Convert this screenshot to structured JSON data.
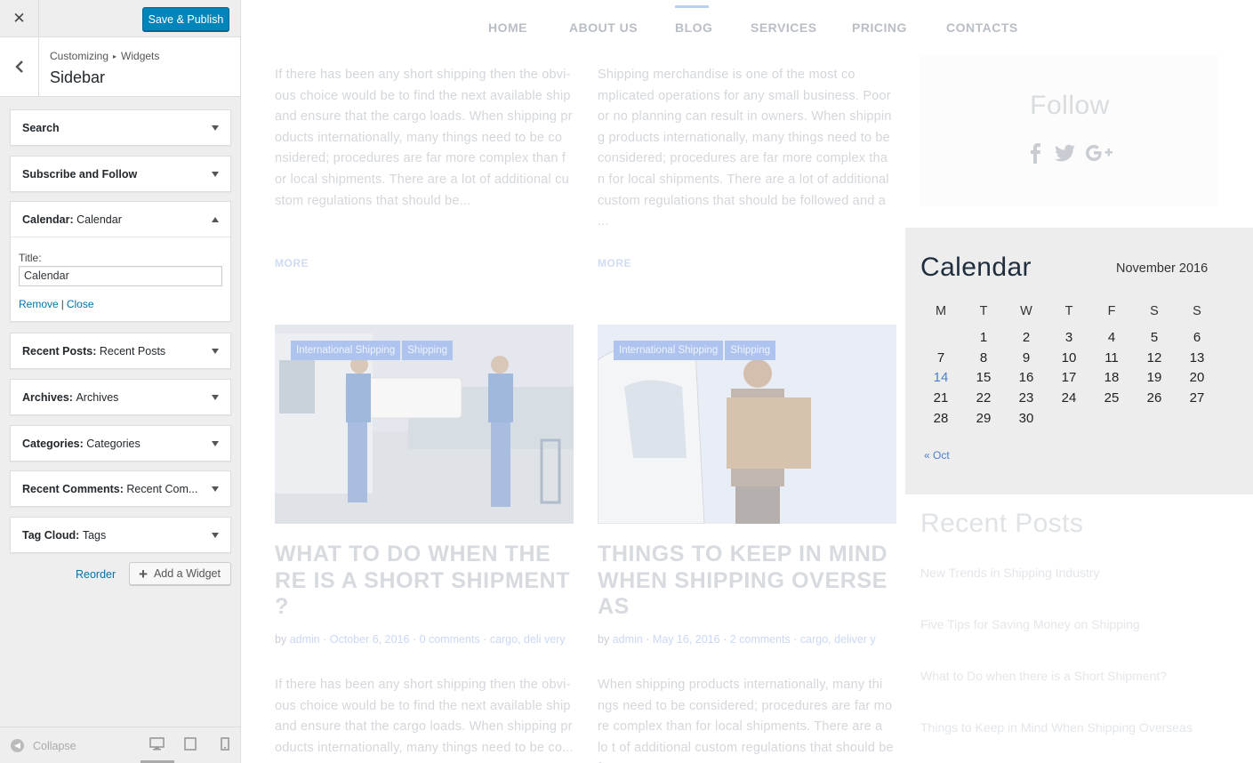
{
  "panel": {
    "publish_label": "Save & Publish",
    "breadcrumb": {
      "root": "Customizing",
      "sep": "▸",
      "current": "Widgets"
    },
    "section_title": "Sidebar",
    "widgets": [
      {
        "prefix": "Search",
        "name": ""
      },
      {
        "prefix": "Subscribe and Follow",
        "name": ""
      },
      {
        "prefix": "Calendar:",
        "name": "Calendar"
      },
      {
        "prefix": "Recent Posts:",
        "name": "Recent Posts"
      },
      {
        "prefix": "Archives:",
        "name": "Archives"
      },
      {
        "prefix": "Categories:",
        "name": "Categories"
      },
      {
        "prefix": "Recent Comments:",
        "name": "Recent Com..."
      },
      {
        "prefix": "Tag Cloud:",
        "name": "Tags"
      }
    ],
    "calendar_form": {
      "title_label": "Title:",
      "title_value": "Calendar",
      "remove_label": "Remove",
      "sep": "|",
      "close_label": "Close"
    },
    "reorder_label": "Reorder",
    "add_widget_label": "Add a Widget",
    "collapse_label": "Collapse"
  },
  "preview": {
    "nav": [
      "HOME",
      "ABOUT US",
      "BLOG",
      "SERVICES",
      "PRICING",
      "CONTACTS"
    ],
    "nav_active": "BLOG",
    "top_posts": [
      {
        "excerpt": "If there has been any short shipping then the obvi-ous choice would be to find the next available ship and ensure that the cargo loads. When shipping pr oducts internationally, many things need to be co nsidered; procedures are far more complex than f or local shipments. There are a lot of additional cu stom regulations that should be...",
        "more": "MORE"
      },
      {
        "excerpt": "Shipping merchandise is one of the most co mplicated operations for any small business. Poor or no planning can result in owners. When shippin g products internationally, many things need to be considered; procedures are far more complex tha n for local shipments. There are a lot of additional custom regulations that should be followed and a ...",
        "more": "MORE"
      }
    ],
    "posts": [
      {
        "tags": [
          "International Shipping",
          "Shipping"
        ],
        "title": "WHAT TO DO WHEN THE RE IS A SHORT SHIPMENT ?",
        "meta": {
          "by": "by",
          "author": "admin",
          "date": "October 6, 2016",
          "comments": "0 comments",
          "cats": "cargo, deli very"
        },
        "excerpt": "If there has been any short shipping then the obvi-ous choice would be to find the next available ship and ensure that the cargo loads. When shipping pr oducts internationally, many things need to be co..."
      },
      {
        "tags": [
          "International Shipping",
          "Shipping"
        ],
        "title": "THINGS TO KEEP IN MIND WHEN SHIPPING OVERSE AS",
        "meta": {
          "by": "by",
          "author": "admin",
          "date": "May 16, 2016",
          "comments": "2 comments",
          "cats": "cargo, deliver y"
        },
        "excerpt": "When shipping products internationally, many thi ngs need to be considered; procedures are far mo re complex than for local shipments. There are a lo t of additional custom regulations that should be f..."
      }
    ],
    "follow_title": "Follow",
    "calendar": {
      "title": "Calendar",
      "month": "November 2016",
      "weekdays": [
        "M",
        "T",
        "W",
        "T",
        "F",
        "S",
        "S"
      ],
      "weeks": [
        [
          "",
          "1",
          "2",
          "3",
          "4",
          "5",
          "6"
        ],
        [
          "7",
          "8",
          "9",
          "10",
          "11",
          "12",
          "13"
        ],
        [
          "14",
          "15",
          "16",
          "17",
          "18",
          "19",
          "20"
        ],
        [
          "21",
          "22",
          "23",
          "24",
          "25",
          "26",
          "27"
        ],
        [
          "28",
          "29",
          "30",
          "",
          "",
          "",
          ""
        ]
      ],
      "today": "14",
      "prev_link": "« Oct"
    },
    "recent_posts": {
      "title": "Recent Posts",
      "items": [
        "New Trends in Shipping Industry",
        "Five Tips for Saving Money on Shipping",
        "What to Do when there is a Short Shipment?",
        "Things to Keep in Mind When Shipping Overseas"
      ]
    }
  },
  "colors": {
    "accent": "#0085ba",
    "link": "#0073aa",
    "calendar_bg": "#ededed",
    "today": "#4a7fd0"
  }
}
